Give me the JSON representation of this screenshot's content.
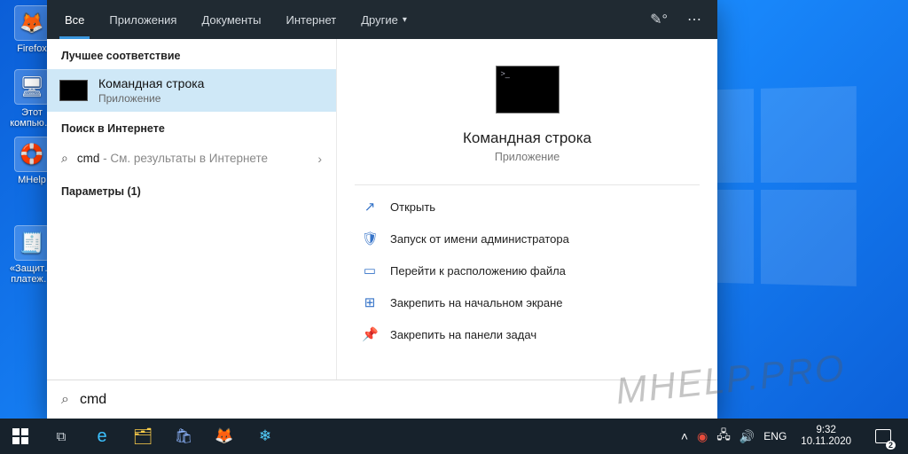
{
  "desktop": {
    "icons": [
      {
        "label": "Firefox",
        "glyph": "🦊"
      },
      {
        "label": "Этот компью…",
        "glyph": "🖥"
      },
      {
        "label": "MHelp",
        "glyph": "🛟"
      },
      {
        "label": "«Защит… платеж…",
        "glyph": "🧾"
      }
    ]
  },
  "tabs": {
    "items": [
      {
        "label": "Все",
        "active": true
      },
      {
        "label": "Приложения"
      },
      {
        "label": "Документы"
      },
      {
        "label": "Интернет"
      },
      {
        "label": "Другие",
        "dropdown": true
      }
    ]
  },
  "left": {
    "best_header": "Лучшее соответствие",
    "best_title": "Командная строка",
    "best_sub": "Приложение",
    "web_header": "Поиск в Интернете",
    "web_query": "cmd",
    "web_hint": " - См. результаты в Интернете",
    "settings_header": "Параметры (1)"
  },
  "right": {
    "title": "Командная строка",
    "sub": "Приложение",
    "actions": [
      {
        "icon": "↗",
        "label": "Открыть"
      },
      {
        "icon": "🛡",
        "label": "Запуск от имени администратора"
      },
      {
        "icon": "▭",
        "label": "Перейти к расположению файла"
      },
      {
        "icon": "⊞",
        "label": "Закрепить на начальном экране"
      },
      {
        "icon": "📌",
        "label": "Закрепить на панели задач"
      }
    ]
  },
  "search": {
    "value": "cmd"
  },
  "tray": {
    "lang": "ENG",
    "time": "9:32",
    "date": "10.11.2020",
    "notif_count": "2"
  },
  "watermark": "MHELP.PRO"
}
